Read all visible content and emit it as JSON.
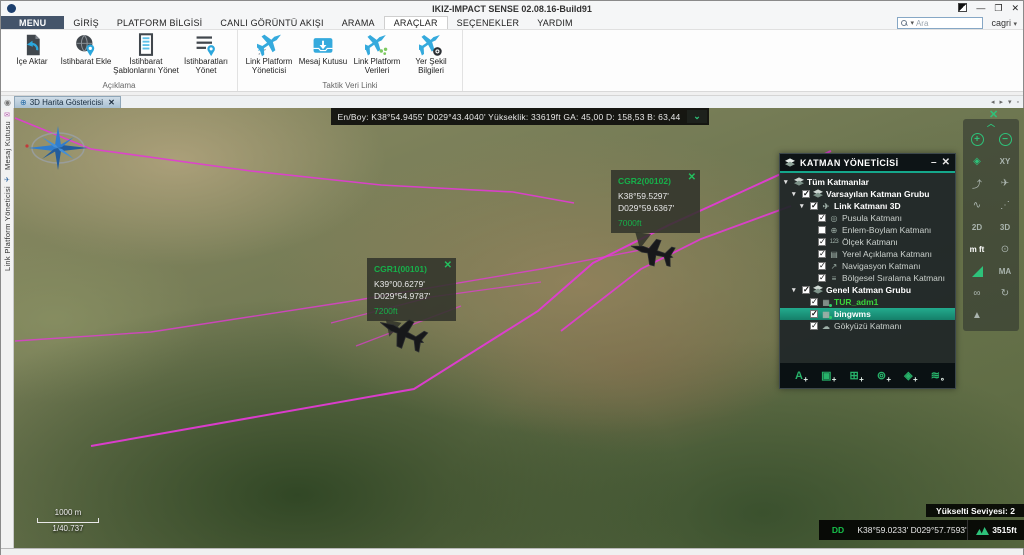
{
  "window": {
    "title": "IKIZ-IMPACT SENSE 02.08.16-Build91",
    "user": "cagri"
  },
  "menu": {
    "tabs": [
      {
        "label": "MENU"
      },
      {
        "label": "GİRİŞ"
      },
      {
        "label": "PLATFORM BİLGİSİ"
      },
      {
        "label": "CANLI GÖRÜNTÜ AKIŞI"
      },
      {
        "label": "ARAMA"
      },
      {
        "label": "ARAÇLAR"
      },
      {
        "label": "SEÇENEKLER"
      },
      {
        "label": "YARDIM"
      }
    ],
    "active_tab": "ARAÇLAR"
  },
  "search": {
    "placeholder": "Ara"
  },
  "ribbon": {
    "groups": [
      {
        "label": "Açıklama",
        "buttons": [
          {
            "label": "İçe Aktar",
            "icon": "import-icon"
          },
          {
            "label": "İstihbarat Ekle",
            "icon": "globe-pin-icon"
          },
          {
            "label": "İstihbarat Şablonlarını Yönet",
            "icon": "document-template-icon"
          },
          {
            "label": "İstihbaratları Yönet",
            "icon": "list-pin-icon"
          }
        ]
      },
      {
        "label": "Taktik Veri Linki",
        "buttons": [
          {
            "label": "Link Platform Yöneticisi",
            "icon": "jet-manager-icon"
          },
          {
            "label": "Mesaj Kutusu",
            "icon": "inbox-icon"
          },
          {
            "label": "Link Platform Verileri",
            "icon": "jet-data-icon"
          },
          {
            "label": "Yer Şekil Bilgileri",
            "icon": "jet-target-icon"
          }
        ]
      }
    ]
  },
  "dock": {
    "document_tab": "3D Harita Göstericisi",
    "left_tabs": [
      "Mesaj Kutusu",
      "Link Platform Yöneticisi"
    ]
  },
  "map": {
    "info_bar": "En/Boy: K38°54.9455' D029°43.4040' Yükseklik: 33619ft GA: 45,00 D: 158,53 B: 63,44",
    "tracks": [
      {
        "id": "CGR1(00101)",
        "lat": "K39°00.6279'",
        "lon": "D029°54.9787'",
        "alt": "7200ft"
      },
      {
        "id": "CGR2(00102)",
        "lat": "K38°59.5297'",
        "lon": "D029°59.6367'",
        "alt": "7000ft"
      }
    ],
    "scale": {
      "distance": "1000 m",
      "ratio": "1/40.737"
    },
    "status": {
      "elevation_level": "Yükselti Seviyesi: 2",
      "format": "DD",
      "coords": "K38°59.0233'  D029°57.7593'",
      "altitude": "3515ft"
    },
    "route_color": "#e23bd4"
  },
  "layer_panel": {
    "title": "KATMAN YÖNETİCİSİ",
    "items": [
      {
        "label": "Tüm Katmanlar",
        "level": 0,
        "icon": "layers-icon",
        "expanded": true
      },
      {
        "label": "Varsayılan Katman Grubu",
        "level": 1,
        "icon": "layers-icon",
        "checked": true,
        "expanded": true
      },
      {
        "label": "Link Katmanı 3D",
        "level": 2,
        "icon": "jet-icon",
        "checked": true,
        "expanded": true
      },
      {
        "label": "Pusula Katmanı",
        "level": 3,
        "icon": "compass-icon",
        "checked": true
      },
      {
        "label": "Enlem-Boylam Katmanı",
        "level": 3,
        "icon": "graticule-icon",
        "checked": false
      },
      {
        "label": "Ölçek Katmanı",
        "level": 3,
        "icon": "scale-icon",
        "checked": true
      },
      {
        "label": "Yerel Açıklama Katmanı",
        "level": 3,
        "icon": "annotation-icon",
        "checked": true
      },
      {
        "label": "Navigasyon Katmanı",
        "level": 3,
        "icon": "navigation-icon",
        "checked": true
      },
      {
        "label": "Bölgesel Sıralama Katmanı",
        "level": 3,
        "icon": "ordering-icon",
        "checked": true
      },
      {
        "label": "Genel Katman Grubu",
        "level": 1,
        "icon": "layers-icon",
        "checked": true,
        "expanded": true
      },
      {
        "label": "TUR_adm1",
        "level": 2,
        "icon": "raster-layer-icon",
        "checked": true,
        "text_color": "#3bd43b"
      },
      {
        "label": "bingwms",
        "level": 2,
        "icon": "raster-layer-icon",
        "checked": true,
        "selected": true
      },
      {
        "label": "Gökyüzü Katmanı",
        "level": 2,
        "icon": "sky-icon",
        "checked": true
      }
    ],
    "toolbar": [
      {
        "name": "add-annotation-button",
        "label": "A"
      },
      {
        "name": "add-image-layer-button"
      },
      {
        "name": "add-diagram-button"
      },
      {
        "name": "add-pin-button"
      },
      {
        "name": "add-layer-button"
      },
      {
        "name": "layer-settings-button"
      }
    ]
  },
  "map_toolbar": {
    "labels": {
      "measure_xy": "XY",
      "view_2d": "2D",
      "view_3d": "3D",
      "units": "m ft",
      "measure_area": "MA"
    }
  },
  "colors": {
    "accent_green": "#2ec27a",
    "panel_teal": "#15a78b",
    "selected_row": "#1aa287",
    "route_magenta": "#e23bd4",
    "ribbon_blue": "#35aadd",
    "menu_tab_navy": "#44546a"
  }
}
